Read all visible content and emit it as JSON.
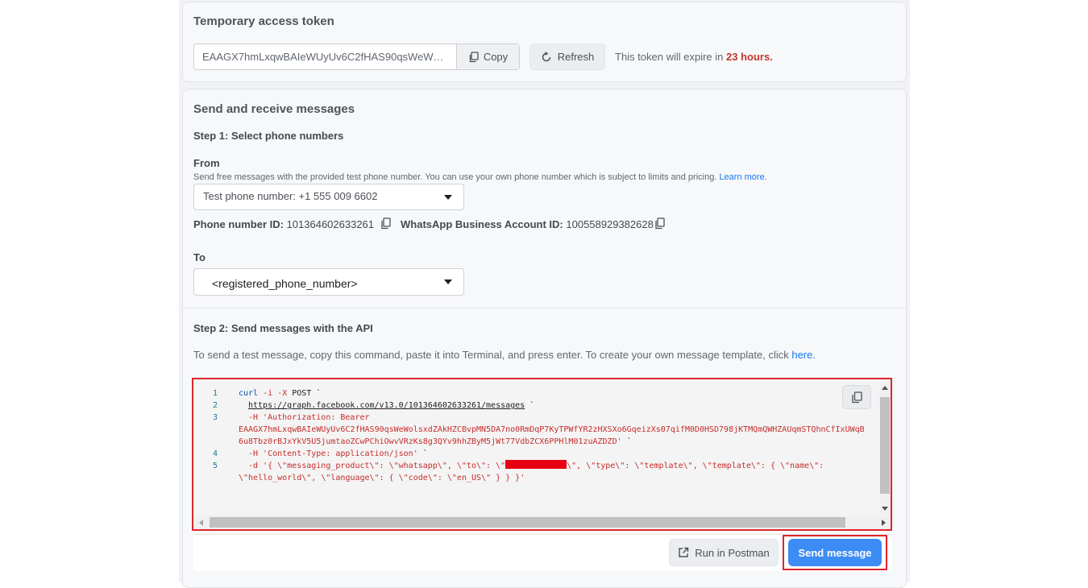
{
  "token_section": {
    "title": "Temporary access token",
    "token_value": "EAAGX7hmLxqwBAIeWUyUv6C2fHAS90qsWeWolsxdZAkHZCBvpMN5DA7no0RmDqP7KyTPWfYR2zHXSXo6GqeizXs07qifM0D0HSD798jKTMQmQWHZAUqmSTQhnCfIxUWqB",
    "copy_label": "Copy",
    "refresh_label": "Refresh",
    "expire_text": "This token will expire in ",
    "expire_value": "23 hours."
  },
  "send_section": {
    "title": "Send and receive messages",
    "step1_title": "Step 1: Select phone numbers",
    "from_label": "From",
    "from_desc": "Send free messages with the provided test phone number. You can use your own phone number which is subject to limits and pricing. ",
    "learn_more": "Learn more.",
    "from_value": "Test phone number: +1 555 009 6602",
    "phone_id_label": "Phone number ID: ",
    "phone_id_value": "101364602633261",
    "waba_label": "WhatsApp Business Account ID: ",
    "waba_value": "100558929382628",
    "to_label": "To",
    "to_value": "<registered_phone_number>",
    "step2_title": "Step 2: Send messages with the API",
    "step2_desc": "To send a test message, copy this command, paste it into Terminal, and press enter. To create your own message template, click ",
    "here_link": "here",
    "step2_desc_end": "."
  },
  "code": {
    "line_numbers": [
      "1",
      "2",
      "3",
      "",
      "",
      "4",
      "5",
      ""
    ],
    "l1_cmd": "curl",
    "l1_flags": " -i -X",
    "l1_rest": " POST `",
    "l2_url_a": "https://graph.facebook.com/v13.",
    "l2_url_b": "0",
    "l2_url_c": "/",
    "l2_url_d": "101364602633261",
    "l2_url_e": "/messages",
    "l2_tail": " `",
    "l3": "-H 'Authorization: Bearer",
    "l3b": "EAAGX7hmLxqwBAIeWUyUv6C2fHAS90qsWeWolsxdZAkHZCBvpMN5DA7no0RmDqP7KyTPWfYR2zHXSXo6GqeizXs07qifM0D0HSD798jKTMQmQWHZAUqmSTQhnCfIxUWqB",
    "l3c": "6u8Tbz0rBJxYkV5U5jumtaoZCwPChiOwvVRzKs8g3QYv9hhZByM5jWt77VdbZCX6PPHlM01zuAZDZD'",
    "l3c_tail": " `",
    "l4": "-H 'Content-Type: application/json'",
    "l4_tail": " `",
    "l5a": "-d '{ \\\"messaging_product\\\": \\\"whatsapp\\\", \\\"to\\\": \\\"",
    "l5b": "\\\", \\\"type\\\": \\\"template\\\", \\\"template\\\": { \\\"name\\\":",
    "l5c": "\\\"hello_world\\\", \\\"language\\\": { \\\"code\\\": \\\"en_US\\\" } } }'"
  },
  "actions": {
    "postman_label": "Run in Postman",
    "send_label": "Send message"
  },
  "colors": {
    "accent": "#3d8cf5",
    "highlight_red": "#e0242b",
    "expire_red": "#c0392b",
    "link_blue": "#1877f2"
  }
}
